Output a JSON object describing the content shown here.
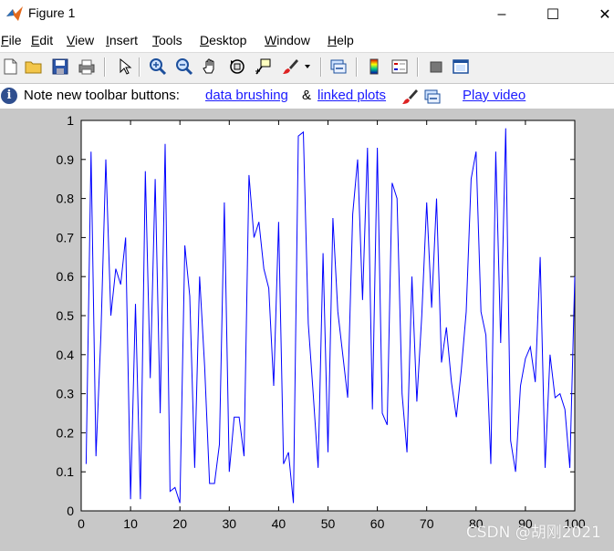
{
  "window": {
    "title": "Figure 1",
    "minimize_glyph": "–",
    "maximize_glyph": "☐",
    "close_glyph": "✕"
  },
  "menu": [
    "File",
    "Edit",
    "View",
    "Insert",
    "Tools",
    "Desktop",
    "Window",
    "Help"
  ],
  "toolbar": {
    "icons": [
      "new-figure-icon",
      "open-file-icon",
      "save-icon",
      "print-icon",
      "edit-plot-arrow-icon",
      "zoom-in-icon",
      "zoom-out-icon",
      "pan-hand-icon",
      "rotate-3d-icon",
      "data-cursor-icon",
      "brush-icon",
      "brush-dropdown-icon",
      "link-plot-icon",
      "insert-colorbar-icon",
      "insert-legend-icon",
      "hide-plot-tools-icon",
      "show-plot-tools-icon"
    ]
  },
  "infobar": {
    "note": "Note new toolbar buttons:",
    "link1": "data brushing",
    "amp": "&",
    "link2": "linked plots",
    "link3": "Play video"
  },
  "watermark": "CSDN @胡刚2021",
  "chart_data": {
    "type": "line",
    "title": "",
    "xlabel": "",
    "ylabel": "",
    "xlim": [
      0,
      100
    ],
    "ylim": [
      0,
      1
    ],
    "xticks": [
      "0",
      "10",
      "20",
      "30",
      "40",
      "50",
      "60",
      "70",
      "80",
      "90",
      "100"
    ],
    "yticks": [
      "0",
      "0.1",
      "0.2",
      "0.3",
      "0.4",
      "0.5",
      "0.6",
      "0.7",
      "0.8",
      "0.9",
      "1"
    ],
    "grid": false,
    "series": [
      {
        "color": "#0000ff",
        "x": [
          1,
          2,
          3,
          4,
          5,
          6,
          7,
          8,
          9,
          10,
          11,
          12,
          13,
          14,
          15,
          16,
          17,
          18,
          19,
          20,
          21,
          22,
          23,
          24,
          25,
          26,
          27,
          28,
          29,
          30,
          31,
          32,
          33,
          34,
          35,
          36,
          37,
          38,
          39,
          40,
          41,
          42,
          43,
          44,
          45,
          46,
          47,
          48,
          49,
          50,
          51,
          52,
          53,
          54,
          55,
          56,
          57,
          58,
          59,
          60,
          61,
          62,
          63,
          64,
          65,
          66,
          67,
          68,
          69,
          70,
          71,
          72,
          73,
          74,
          75,
          76,
          77,
          78,
          79,
          80,
          81,
          82,
          83,
          84,
          85,
          86,
          87,
          88,
          89,
          90,
          91,
          92,
          93,
          94,
          95,
          96,
          97,
          98,
          99,
          100
        ],
        "values": [
          0.12,
          0.92,
          0.14,
          0.45,
          0.9,
          0.5,
          0.62,
          0.58,
          0.7,
          0.03,
          0.53,
          0.03,
          0.87,
          0.34,
          0.85,
          0.25,
          0.94,
          0.05,
          0.06,
          0.02,
          0.68,
          0.55,
          0.11,
          0.6,
          0.37,
          0.07,
          0.07,
          0.17,
          0.79,
          0.1,
          0.24,
          0.24,
          0.14,
          0.86,
          0.7,
          0.74,
          0.62,
          0.57,
          0.32,
          0.74,
          0.12,
          0.15,
          0.02,
          0.96,
          0.97,
          0.48,
          0.3,
          0.11,
          0.66,
          0.15,
          0.75,
          0.51,
          0.4,
          0.29,
          0.76,
          0.9,
          0.54,
          0.93,
          0.26,
          0.93,
          0.25,
          0.22,
          0.84,
          0.8,
          0.3,
          0.15,
          0.6,
          0.28,
          0.5,
          0.79,
          0.52,
          0.8,
          0.38,
          0.47,
          0.33,
          0.24,
          0.36,
          0.51,
          0.85,
          0.92,
          0.51,
          0.45,
          0.12,
          0.92,
          0.43,
          0.98,
          0.18,
          0.1,
          0.32,
          0.39,
          0.42,
          0.33,
          0.65,
          0.11,
          0.4,
          0.29,
          0.3,
          0.26,
          0.11,
          0.6
        ]
      }
    ]
  }
}
